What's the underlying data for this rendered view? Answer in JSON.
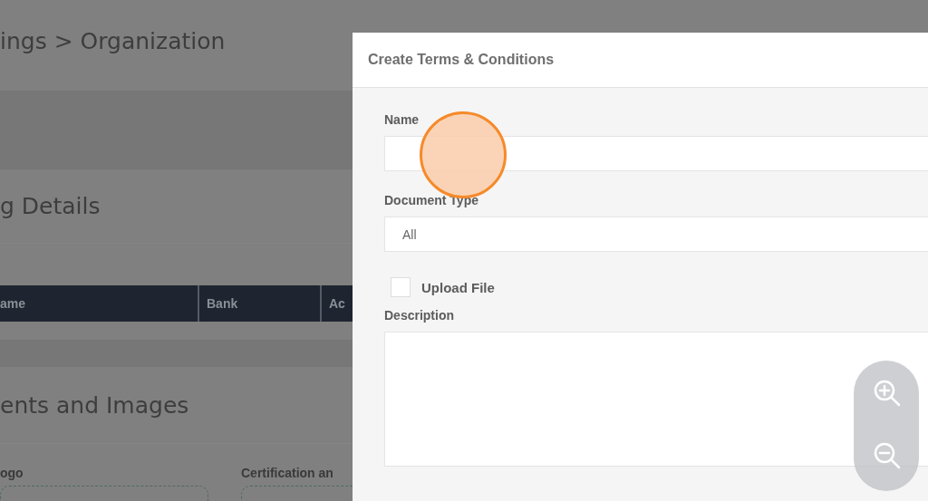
{
  "background": {
    "title": "ings > Organization",
    "section_1": "g Details",
    "table": {
      "columns": [
        "ame",
        "Bank",
        "Ac"
      ]
    },
    "section_2": "ents and Images",
    "labels": [
      "ogo",
      "Certification an"
    ]
  },
  "modal": {
    "title": "Create Terms & Conditions",
    "fields": [
      {
        "kind": "text",
        "label": "Name"
      },
      {
        "kind": "select",
        "label": "Document Type",
        "value": "All"
      },
      {
        "kind": "checkbox",
        "label": "Upload File",
        "checked": false
      },
      {
        "kind": "textarea",
        "label": "Description"
      }
    ]
  }
}
